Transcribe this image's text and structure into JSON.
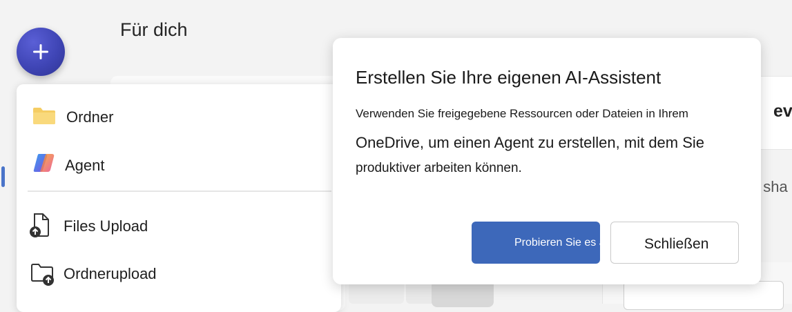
{
  "page": {
    "title": "Für dich"
  },
  "fab": {
    "icon": "plus-icon"
  },
  "background": {
    "right_card_text": "eval",
    "right_text": "el sha"
  },
  "menu": {
    "items": [
      {
        "label": "Ordner",
        "icon": "folder-icon"
      },
      {
        "label": "Agent",
        "icon": "copilot-icon"
      },
      {
        "label": "Files Upload",
        "icon": "file-upload-icon"
      },
      {
        "label": "Ordnerupload",
        "icon": "folder-upload-icon"
      }
    ]
  },
  "popover": {
    "title": "Erstellen Sie Ihre eigenen AI-Assistent",
    "body_line1": "Verwenden Sie freigegebene Ressourcen oder Dateien in Ihrem",
    "body_line2": "OneDrive, um einen Agent zu erstellen, mit dem Sie",
    "body_line3": "produktiver arbeiten können.",
    "primary_button": "Probieren Sie es aus",
    "secondary_button": "Schließen"
  },
  "colors": {
    "accent": "#3d68ba",
    "fab": "#3f45b5",
    "folder": "#f2c14e"
  }
}
